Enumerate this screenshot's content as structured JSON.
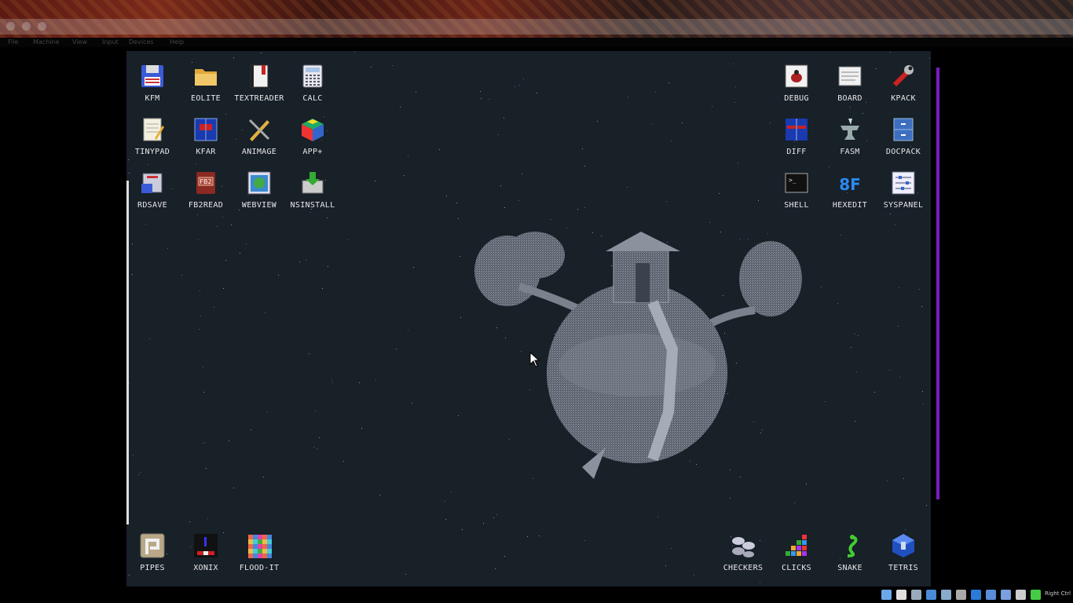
{
  "host": {
    "menu": [
      "File",
      "Machine",
      "View",
      "Input",
      "Devices",
      "Help"
    ],
    "host_key_label": "Right Ctrl",
    "tray_icons": [
      "optical-disc-icon",
      "usb-icon",
      "network-icon",
      "shared-folder-icon",
      "display-icon",
      "record-icon",
      "mouse-integration-icon",
      "capture-icon",
      "cpu-icon",
      "network-activity-icon",
      "host-key-arrow-icon"
    ]
  },
  "desktop": {
    "top_left": [
      [
        {
          "label": "KFM",
          "icon": "floppy-disk-icon"
        },
        {
          "label": "EOLITE",
          "icon": "folder-icon"
        },
        {
          "label": "TEXTREADER",
          "icon": "book-icon"
        },
        {
          "label": "CALC",
          "icon": "calculator-icon"
        }
      ],
      [
        {
          "label": "TINYPAD",
          "icon": "notepad-icon"
        },
        {
          "label": "KFAR",
          "icon": "two-panel-manager-icon"
        },
        {
          "label": "ANIMAGE",
          "icon": "pencil-brush-icon"
        },
        {
          "label": "APP+",
          "icon": "rubik-cube-icon"
        }
      ],
      [
        {
          "label": "RDSAVE",
          "icon": "ramdisk-save-icon"
        },
        {
          "label": "FB2READ",
          "icon": "fb2-book-icon"
        },
        {
          "label": "WEBVIEW",
          "icon": "globe-window-icon"
        },
        {
          "label": "NSINSTALL",
          "icon": "install-arrow-icon"
        }
      ]
    ],
    "top_right": [
      [
        {
          "label": "DEBUG",
          "icon": "bug-icon"
        },
        {
          "label": "BOARD",
          "icon": "board-window-icon"
        },
        {
          "label": "KPACK",
          "icon": "wrench-icon"
        }
      ],
      [
        {
          "label": "DIFF",
          "icon": "diff-icon"
        },
        {
          "label": "FASM",
          "icon": "anvil-icon"
        },
        {
          "label": "DOCPACK",
          "icon": "cabinet-icon"
        }
      ],
      [
        {
          "label": "SHELL",
          "icon": "terminal-icon"
        },
        {
          "label": "HEXEDIT",
          "icon": "hex-editor-icon"
        },
        {
          "label": "SYSPANEL",
          "icon": "sliders-icon"
        }
      ]
    ],
    "bottom_left": [
      {
        "label": "PIPES",
        "icon": "pipes-icon"
      },
      {
        "label": "XONIX",
        "icon": "xonix-icon"
      },
      {
        "label": "FLOOD-IT",
        "icon": "flood-grid-icon"
      }
    ],
    "bottom_right": [
      {
        "label": "CHECKERS",
        "icon": "checkers-icon"
      },
      {
        "label": "CLICKS",
        "icon": "clicks-icon"
      },
      {
        "label": "SNAKE",
        "icon": "snake-icon"
      },
      {
        "label": "TETRIS",
        "icon": "tetris-icon"
      }
    ],
    "colors": {
      "background": "#182028",
      "label": "#e8e8e8",
      "accent_scroll": "#7a1cc4"
    }
  }
}
